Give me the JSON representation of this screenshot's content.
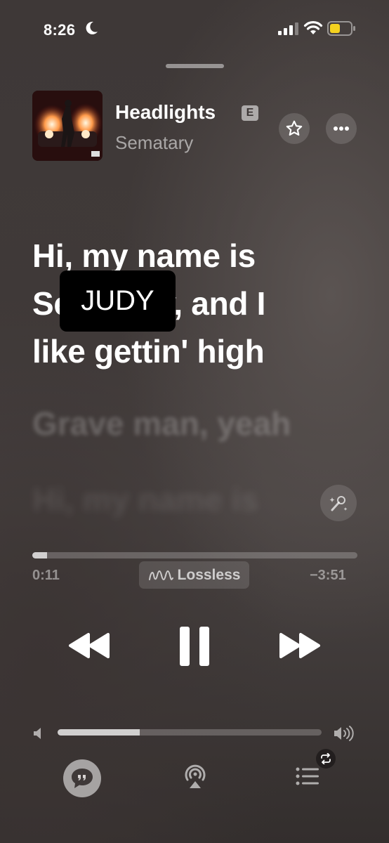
{
  "status_bar": {
    "time": "8:26",
    "focus_icon": "moon-icon",
    "battery_color": "#f4d21f"
  },
  "now_playing": {
    "title": "Headlights",
    "explicit_badge": "E",
    "artist": "Sematary",
    "artwork_icon": "album-artwork"
  },
  "lyrics": {
    "active_lines": [
      "Hi, my name is",
      "Sematary, and I",
      "like gettin' high"
    ],
    "redaction_label": "JUDY",
    "upcoming_lines": [
      "Grave man, yeah",
      "Hi, my name is"
    ]
  },
  "playback": {
    "elapsed": "0:11",
    "remaining": "−3:51",
    "progress_fraction": 0.045,
    "quality_label": "Lossless"
  },
  "volume": {
    "level_fraction": 0.31
  },
  "colors": {
    "background": "#403a39",
    "text_primary": "#ffffff",
    "text_secondary": "#9a9594"
  }
}
